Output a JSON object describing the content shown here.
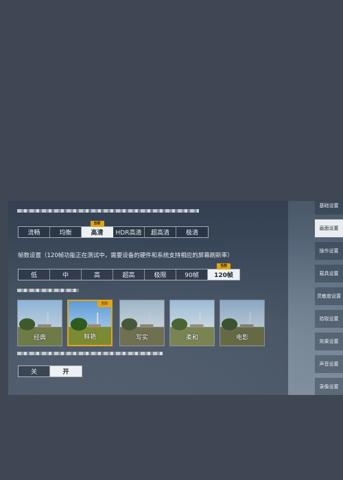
{
  "quality": {
    "options": [
      "流畅",
      "均衡",
      "高清",
      "HDR高清",
      "超高清",
      "极清"
    ],
    "selected_index": 2,
    "current_tag": "当前"
  },
  "fps": {
    "label": "帧数设置（120帧功能正在测试中，需要设备的硬件和系统支持相应的屏幕刷新率）",
    "options": [
      "低",
      "中",
      "高",
      "超高",
      "极限",
      "90帧",
      "120帧"
    ],
    "selected_index": 6,
    "current_tag": "当前"
  },
  "styles": {
    "items": [
      "经典",
      "鲜艳",
      "写实",
      "柔和",
      "电影"
    ],
    "selected_index": 1,
    "current_tag": "当前"
  },
  "toggle": {
    "options": [
      "关",
      "开"
    ],
    "selected_index": 1
  },
  "sidebar": {
    "tabs": [
      "基础设置",
      "画面设置",
      "操作设置",
      "载具设置",
      "灵敏度设置",
      "拾取设置",
      "效果设置",
      "声音设置",
      "录像设置"
    ],
    "selected_index": 1
  }
}
